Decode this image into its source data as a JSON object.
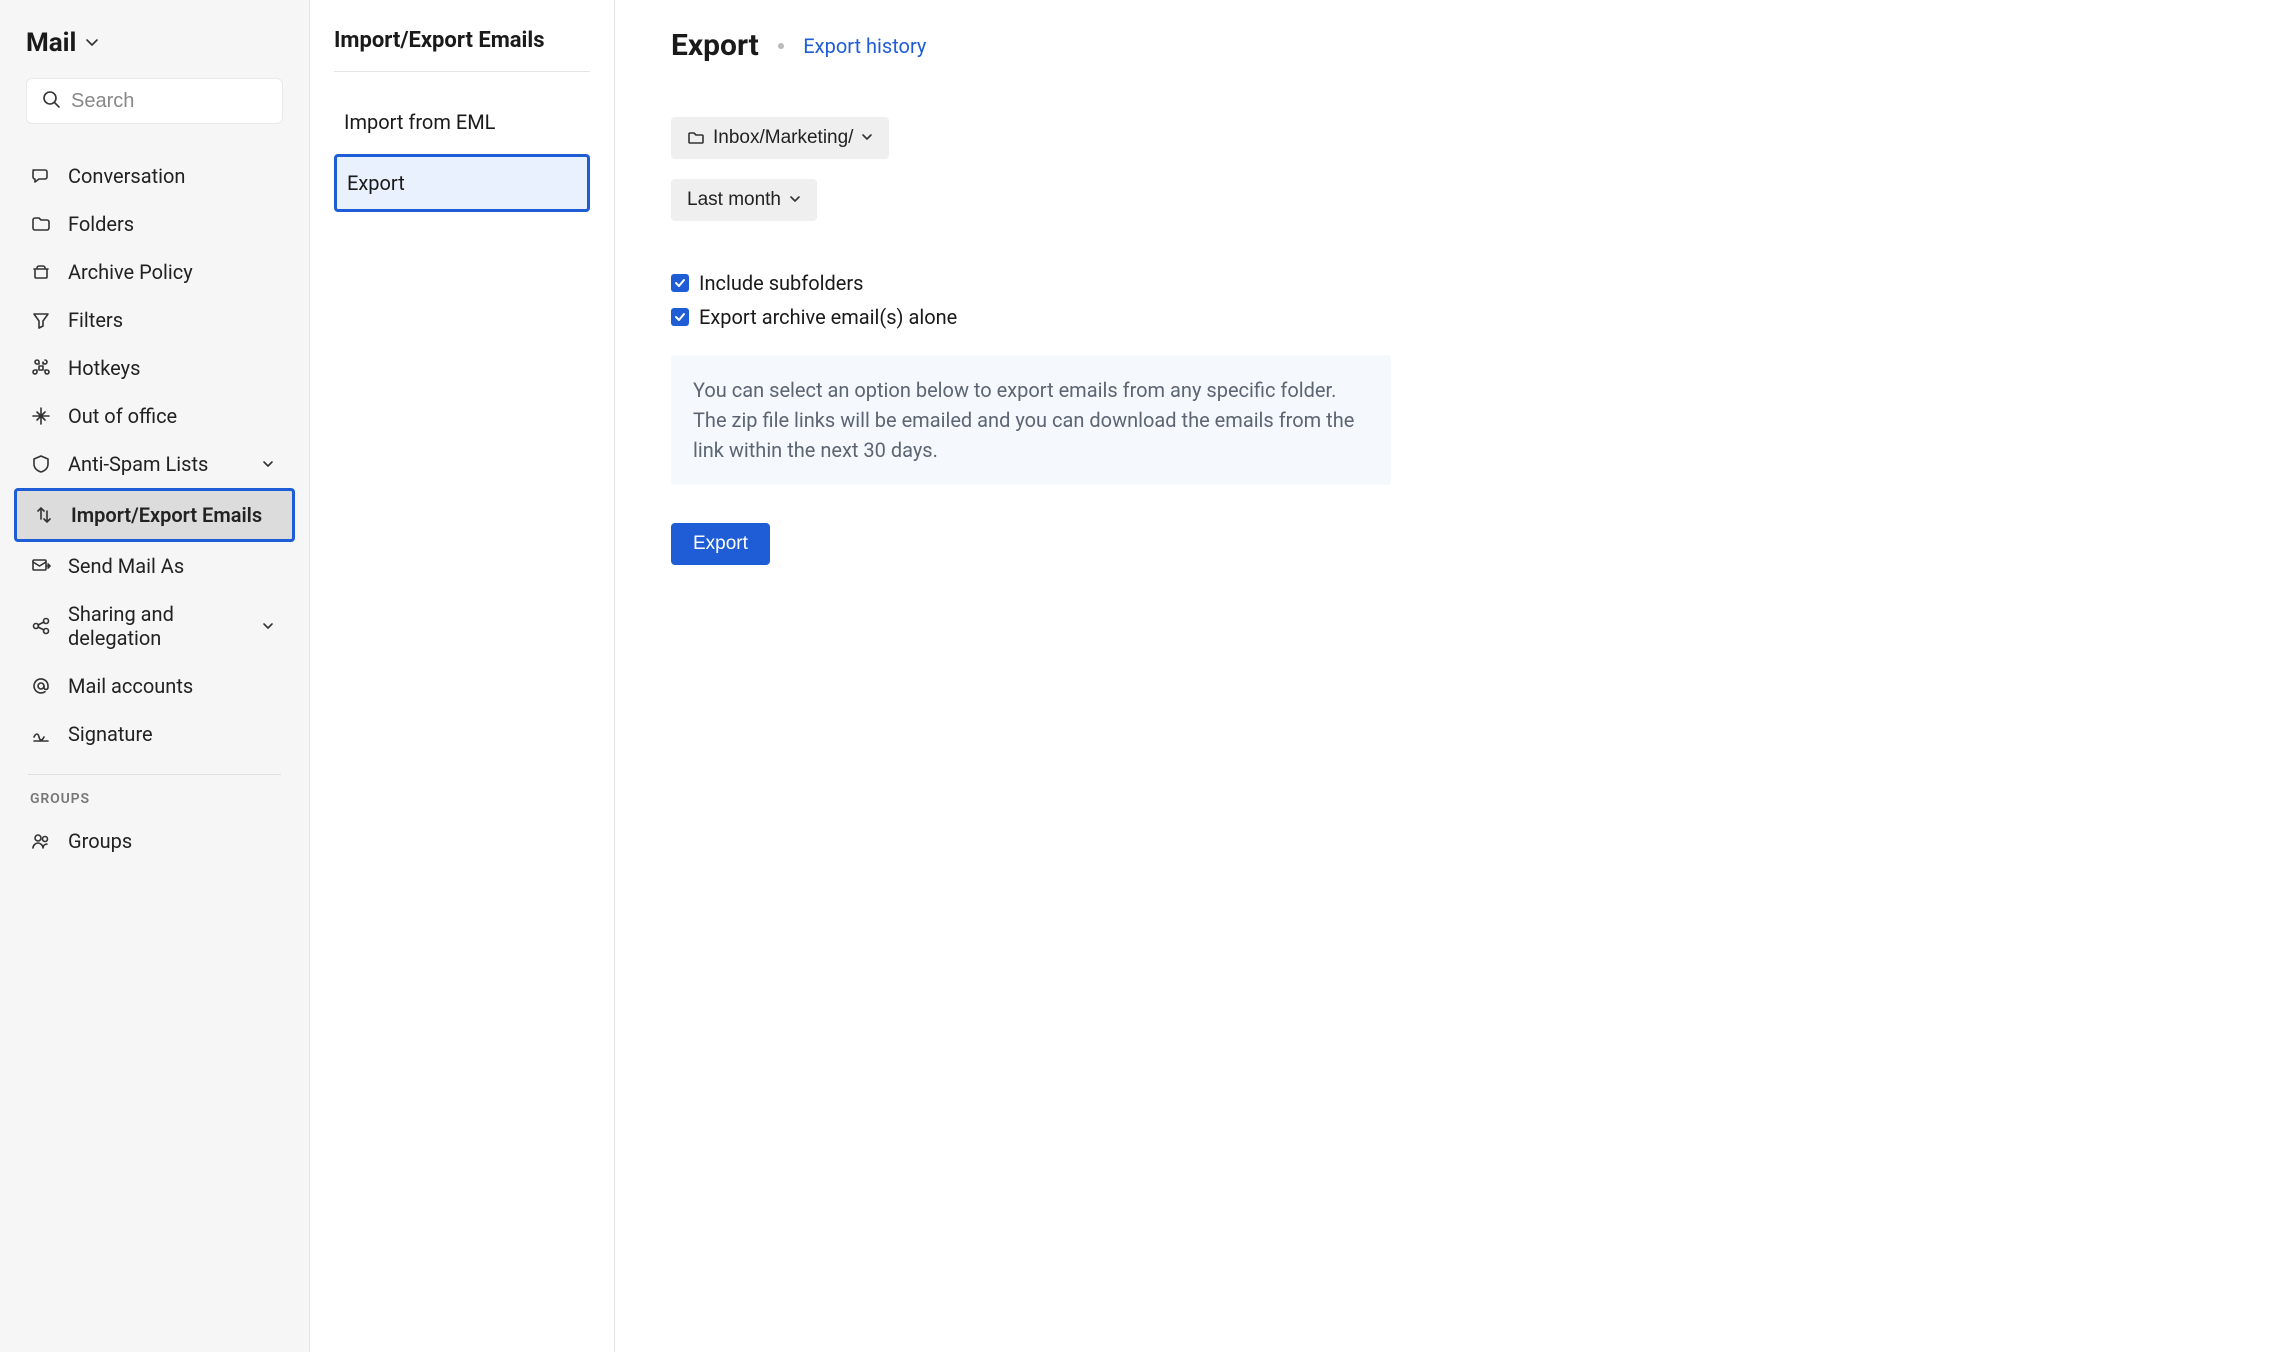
{
  "sidebar": {
    "title": "Mail",
    "search_placeholder": "Search",
    "items": [
      {
        "id": "conversation",
        "label": "Conversation",
        "icon": "conversation-icon"
      },
      {
        "id": "folders",
        "label": "Folders",
        "icon": "folder-icon"
      },
      {
        "id": "archive-policy",
        "label": "Archive Policy",
        "icon": "archive-icon"
      },
      {
        "id": "filters",
        "label": "Filters",
        "icon": "filter-icon"
      },
      {
        "id": "hotkeys",
        "label": "Hotkeys",
        "icon": "command-icon"
      },
      {
        "id": "out-of-office",
        "label": "Out of office",
        "icon": "airplane-icon"
      },
      {
        "id": "anti-spam",
        "label": "Anti-Spam Lists",
        "icon": "shield-icon",
        "expandable": true
      },
      {
        "id": "import-export",
        "label": "Import/Export Emails",
        "icon": "transfer-icon",
        "active": true
      },
      {
        "id": "send-mail-as",
        "label": "Send Mail As",
        "icon": "send-as-icon"
      },
      {
        "id": "sharing",
        "label": "Sharing and delegation",
        "icon": "share-icon",
        "expandable": true
      },
      {
        "id": "mail-accounts",
        "label": "Mail accounts",
        "icon": "at-icon"
      },
      {
        "id": "signature",
        "label": "Signature",
        "icon": "signature-icon"
      }
    ],
    "groups_label": "GROUPS",
    "groups_items": [
      {
        "id": "groups",
        "label": "Groups",
        "icon": "group-icon"
      }
    ]
  },
  "subpanel": {
    "title": "Import/Export Emails",
    "items": [
      {
        "id": "import-eml",
        "label": "Import from EML"
      },
      {
        "id": "export",
        "label": "Export",
        "active": true
      }
    ]
  },
  "main": {
    "title": "Export",
    "history_link": "Export history",
    "folder_selector": "Inbox/Marketing/",
    "range_selector": "Last month",
    "check_include_subfolders": "Include subfolders",
    "check_export_archive": "Export archive email(s) alone",
    "notice": "You can select an option below to export emails from any specific folder. The zip file links will be emailed and you can download the emails from the link within the next 30 days.",
    "export_button": "Export"
  }
}
